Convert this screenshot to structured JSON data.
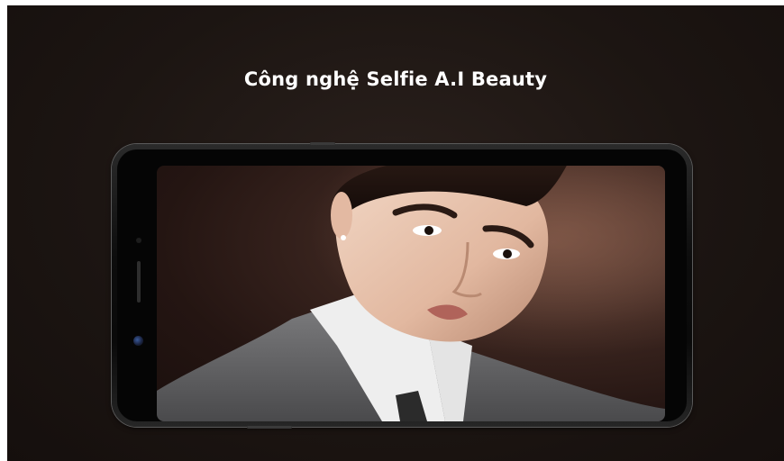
{
  "headline": "Công nghệ Selfie A.I Beauty",
  "colors": {
    "background": "#1c1512",
    "headline_text": "#ffffff",
    "phone_body": "#0a0a0a"
  },
  "screen": {
    "content": "portrait-photo"
  }
}
